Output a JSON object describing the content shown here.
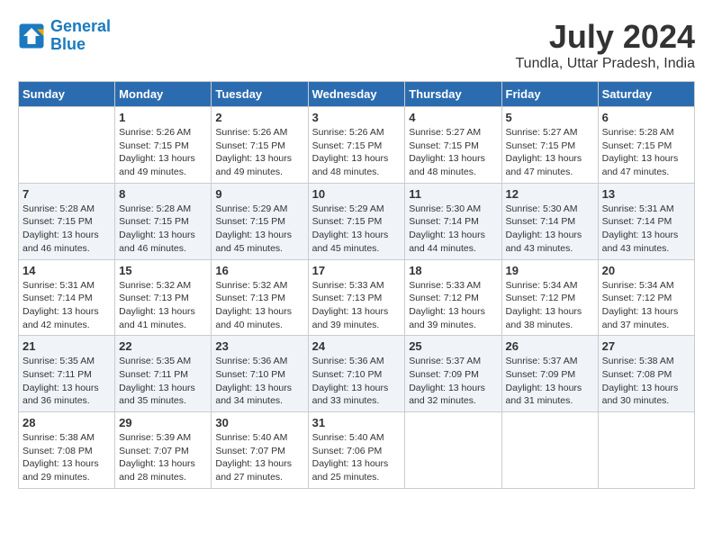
{
  "header": {
    "logo_line1": "General",
    "logo_line2": "Blue",
    "month_year": "July 2024",
    "location": "Tundla, Uttar Pradesh, India"
  },
  "weekdays": [
    "Sunday",
    "Monday",
    "Tuesday",
    "Wednesday",
    "Thursday",
    "Friday",
    "Saturday"
  ],
  "weeks": [
    [
      {
        "day": "",
        "empty": true
      },
      {
        "day": "1",
        "sunrise": "5:26 AM",
        "sunset": "7:15 PM",
        "daylight": "13 hours and 49 minutes."
      },
      {
        "day": "2",
        "sunrise": "5:26 AM",
        "sunset": "7:15 PM",
        "daylight": "13 hours and 49 minutes."
      },
      {
        "day": "3",
        "sunrise": "5:26 AM",
        "sunset": "7:15 PM",
        "daylight": "13 hours and 48 minutes."
      },
      {
        "day": "4",
        "sunrise": "5:27 AM",
        "sunset": "7:15 PM",
        "daylight": "13 hours and 48 minutes."
      },
      {
        "day": "5",
        "sunrise": "5:27 AM",
        "sunset": "7:15 PM",
        "daylight": "13 hours and 47 minutes."
      },
      {
        "day": "6",
        "sunrise": "5:28 AM",
        "sunset": "7:15 PM",
        "daylight": "13 hours and 47 minutes."
      }
    ],
    [
      {
        "day": "7",
        "sunrise": "5:28 AM",
        "sunset": "7:15 PM",
        "daylight": "13 hours and 46 minutes."
      },
      {
        "day": "8",
        "sunrise": "5:28 AM",
        "sunset": "7:15 PM",
        "daylight": "13 hours and 46 minutes."
      },
      {
        "day": "9",
        "sunrise": "5:29 AM",
        "sunset": "7:15 PM",
        "daylight": "13 hours and 45 minutes."
      },
      {
        "day": "10",
        "sunrise": "5:29 AM",
        "sunset": "7:15 PM",
        "daylight": "13 hours and 45 minutes."
      },
      {
        "day": "11",
        "sunrise": "5:30 AM",
        "sunset": "7:14 PM",
        "daylight": "13 hours and 44 minutes."
      },
      {
        "day": "12",
        "sunrise": "5:30 AM",
        "sunset": "7:14 PM",
        "daylight": "13 hours and 43 minutes."
      },
      {
        "day": "13",
        "sunrise": "5:31 AM",
        "sunset": "7:14 PM",
        "daylight": "13 hours and 43 minutes."
      }
    ],
    [
      {
        "day": "14",
        "sunrise": "5:31 AM",
        "sunset": "7:14 PM",
        "daylight": "13 hours and 42 minutes."
      },
      {
        "day": "15",
        "sunrise": "5:32 AM",
        "sunset": "7:13 PM",
        "daylight": "13 hours and 41 minutes."
      },
      {
        "day": "16",
        "sunrise": "5:32 AM",
        "sunset": "7:13 PM",
        "daylight": "13 hours and 40 minutes."
      },
      {
        "day": "17",
        "sunrise": "5:33 AM",
        "sunset": "7:13 PM",
        "daylight": "13 hours and 39 minutes."
      },
      {
        "day": "18",
        "sunrise": "5:33 AM",
        "sunset": "7:12 PM",
        "daylight": "13 hours and 39 minutes."
      },
      {
        "day": "19",
        "sunrise": "5:34 AM",
        "sunset": "7:12 PM",
        "daylight": "13 hours and 38 minutes."
      },
      {
        "day": "20",
        "sunrise": "5:34 AM",
        "sunset": "7:12 PM",
        "daylight": "13 hours and 37 minutes."
      }
    ],
    [
      {
        "day": "21",
        "sunrise": "5:35 AM",
        "sunset": "7:11 PM",
        "daylight": "13 hours and 36 minutes."
      },
      {
        "day": "22",
        "sunrise": "5:35 AM",
        "sunset": "7:11 PM",
        "daylight": "13 hours and 35 minutes."
      },
      {
        "day": "23",
        "sunrise": "5:36 AM",
        "sunset": "7:10 PM",
        "daylight": "13 hours and 34 minutes."
      },
      {
        "day": "24",
        "sunrise": "5:36 AM",
        "sunset": "7:10 PM",
        "daylight": "13 hours and 33 minutes."
      },
      {
        "day": "25",
        "sunrise": "5:37 AM",
        "sunset": "7:09 PM",
        "daylight": "13 hours and 32 minutes."
      },
      {
        "day": "26",
        "sunrise": "5:37 AM",
        "sunset": "7:09 PM",
        "daylight": "13 hours and 31 minutes."
      },
      {
        "day": "27",
        "sunrise": "5:38 AM",
        "sunset": "7:08 PM",
        "daylight": "13 hours and 30 minutes."
      }
    ],
    [
      {
        "day": "28",
        "sunrise": "5:38 AM",
        "sunset": "7:08 PM",
        "daylight": "13 hours and 29 minutes."
      },
      {
        "day": "29",
        "sunrise": "5:39 AM",
        "sunset": "7:07 PM",
        "daylight": "13 hours and 28 minutes."
      },
      {
        "day": "30",
        "sunrise": "5:40 AM",
        "sunset": "7:07 PM",
        "daylight": "13 hours and 27 minutes."
      },
      {
        "day": "31",
        "sunrise": "5:40 AM",
        "sunset": "7:06 PM",
        "daylight": "13 hours and 25 minutes."
      },
      {
        "day": "",
        "empty": true
      },
      {
        "day": "",
        "empty": true
      },
      {
        "day": "",
        "empty": true
      }
    ]
  ]
}
